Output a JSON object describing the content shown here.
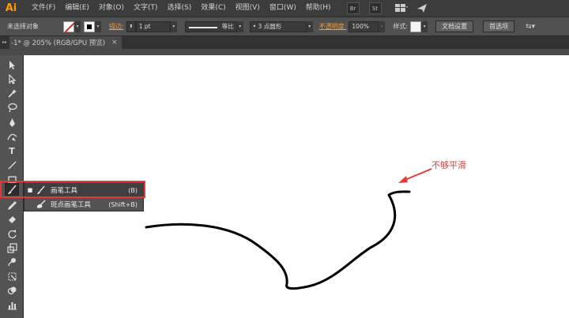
{
  "app": {
    "logo": "Ai"
  },
  "menubar": {
    "items": [
      "文件(F)",
      "编辑(E)",
      "对象(O)",
      "文字(T)",
      "选择(S)",
      "效果(C)",
      "视图(V)",
      "窗口(W)",
      "帮助(H)"
    ],
    "buttons": {
      "bridge": "Br",
      "stock": "St"
    }
  },
  "controlbar": {
    "selection_status": "未选择对象",
    "stroke_label": "描边:",
    "stroke_weight": "1 pt",
    "profile_label": "等比",
    "brush_label": "• 3 点圆形",
    "opacity_label": "不透明度:",
    "opacity_value": "100%",
    "style_label": "样式:",
    "doc_setup_button": "文档设置",
    "preferences_button": "首选项"
  },
  "document_tab": {
    "title": "-1* @ 205% (RGB/GPU 预览)",
    "close_icon": "close-icon"
  },
  "toolbar": {
    "tools": [
      "selection-tool-icon",
      "direct-selection-tool-icon",
      "magic-wand-icon",
      "lasso-icon",
      "pen-tool-icon",
      "curvature-tool-icon",
      "type-tool-icon",
      "line-segment-tool-icon",
      "rectangle-tool-icon",
      "paintbrush-tool-icon",
      "pencil-tool-icon",
      "eraser-tool-icon",
      "rotate-tool-icon",
      "scale-tool-icon",
      "warp-tool-icon",
      "free-transform-icon",
      "shape-builder-icon",
      "perspective-grid-icon",
      "graph-tool-icon"
    ]
  },
  "flyout": {
    "items": [
      {
        "name": "画笔工具",
        "shortcut": "(B)",
        "selected": true
      },
      {
        "name": "斑点画笔工具",
        "shortcut": "(Shift+B)",
        "selected": false
      }
    ]
  },
  "annotation": {
    "text": "不够平滑",
    "color": "#e53935"
  },
  "colors": {
    "menubar_bg": "#3c3c3c",
    "controlbar_bg": "#505050",
    "toolbar_bg": "#535353",
    "logo": "#ff9a00",
    "highlight": "#e53935"
  }
}
